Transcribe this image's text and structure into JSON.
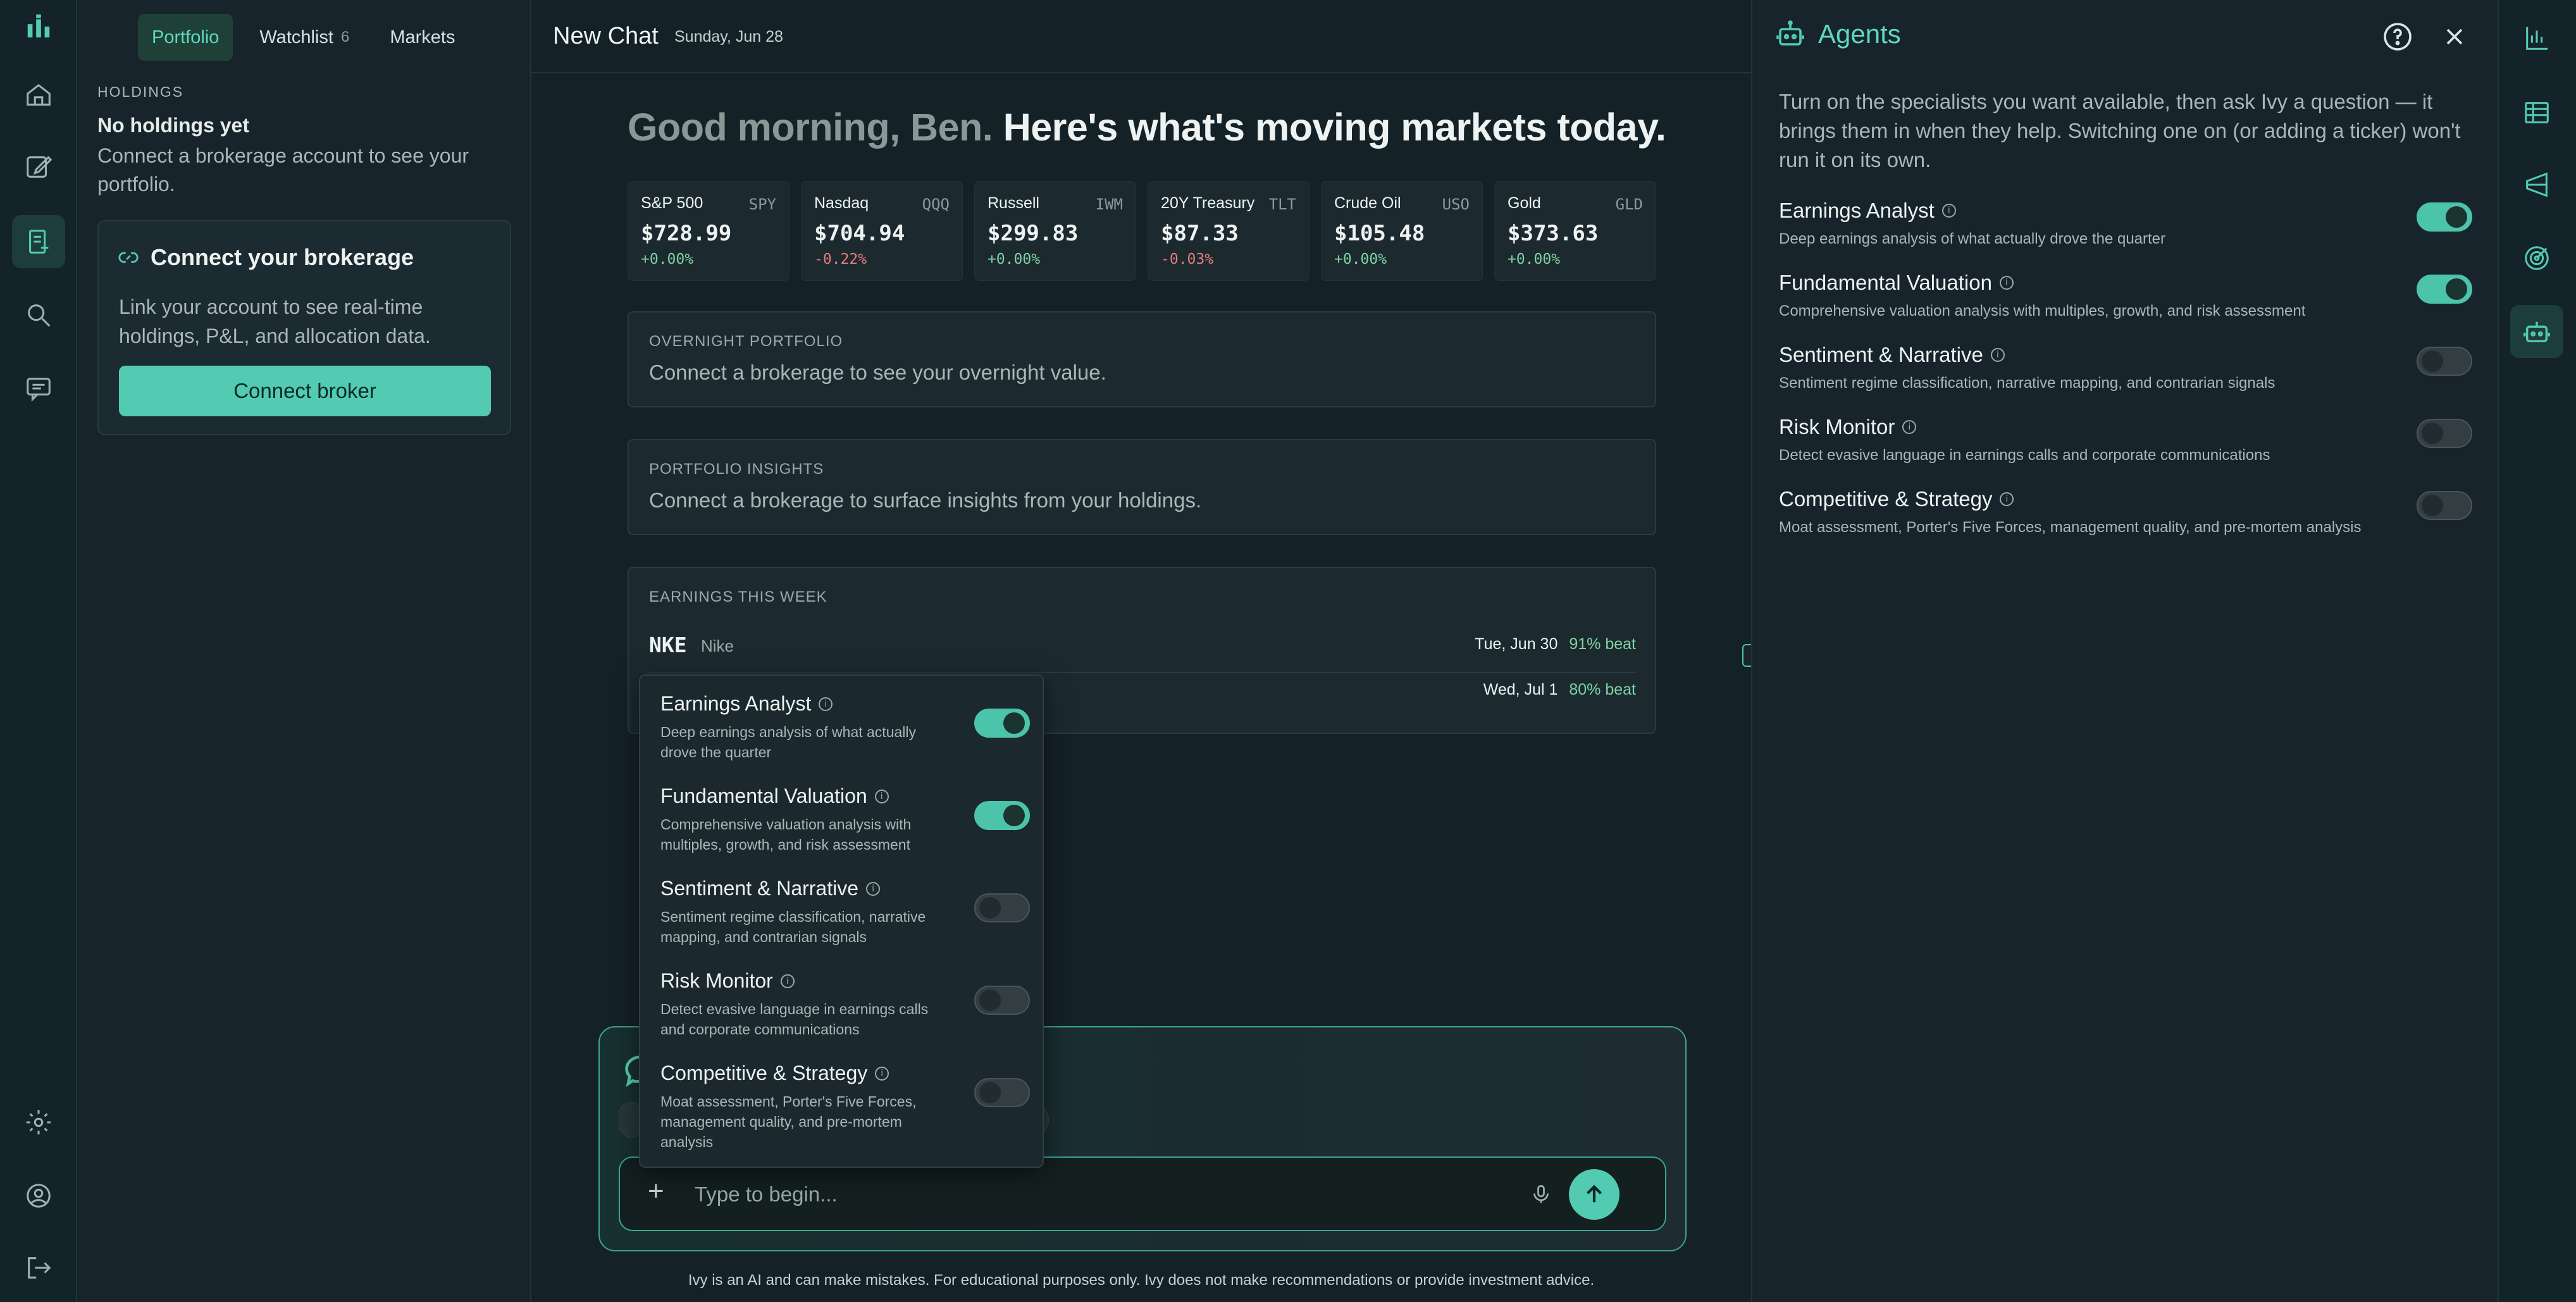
{
  "left_rail": {
    "items": [
      "logo-icon",
      "home-icon",
      "edit-icon",
      "portfolio-icon",
      "search-icon",
      "chat-icon",
      "settings-icon",
      "account-icon",
      "logout-icon"
    ]
  },
  "portfolio_panel": {
    "tabs": [
      {
        "label": "Portfolio",
        "active": true
      },
      {
        "label": "Watchlist",
        "count": "6"
      },
      {
        "label": "Markets"
      }
    ],
    "holdings_label": "HOLDINGS",
    "no_holdings_title": "No holdings yet",
    "no_holdings_desc": "Connect a brokerage account to see your portfolio.",
    "connect_card": {
      "title": "Connect your brokerage",
      "desc": "Link your account to see real-time holdings, P&L, and allocation data.",
      "button": "Connect broker"
    }
  },
  "header": {
    "title": "New Chat",
    "date": "Sunday, Jun 28"
  },
  "greeting": {
    "part1": "Good morning, Ben.",
    "part2": "Here's what's moving markets today."
  },
  "tickers": [
    {
      "name": "S&P 500",
      "symbol": "SPY",
      "price": "$728.99",
      "change": "+0.00%",
      "direction": "pos"
    },
    {
      "name": "Nasdaq",
      "symbol": "QQQ",
      "price": "$704.94",
      "change": "-0.22%",
      "direction": "neg"
    },
    {
      "name": "Russell",
      "symbol": "IWM",
      "price": "$299.83",
      "change": "+0.00%",
      "direction": "pos"
    },
    {
      "name": "20Y Treasury",
      "symbol": "TLT",
      "price": "$87.33",
      "change": "-0.03%",
      "direction": "neg"
    },
    {
      "name": "Crude Oil",
      "symbol": "USO",
      "price": "$105.48",
      "change": "+0.00%",
      "direction": "pos"
    },
    {
      "name": "Gold",
      "symbol": "GLD",
      "price": "$373.63",
      "change": "+0.00%",
      "direction": "pos"
    }
  ],
  "overnight": {
    "label": "OVERNIGHT PORTFOLIO",
    "text": "Connect a brokerage to see your overnight value."
  },
  "insights": {
    "label": "PORTFOLIO INSIGHTS",
    "text": "Connect a brokerage to surface insights from your holdings."
  },
  "earnings": {
    "label": "EARNINGS THIS WEEK",
    "rows": [
      {
        "ticker": "NKE",
        "company": "Nike",
        "date": "Tue, Jun 30",
        "beat": "91% beat"
      },
      {
        "ticker": "",
        "company": "",
        "date": "Wed, Jul 1",
        "beat": "80% beat"
      }
    ]
  },
  "composer": {
    "placeholder": "Type to begin...",
    "plus": "+"
  },
  "disclaimer": "Ivy is an AI and can make mistakes. For educational purposes only. Ivy does not make recommendations or provide investment advice.",
  "popover": {
    "items": [
      {
        "title": "Earnings Analyst",
        "desc": "Deep earnings analysis of what actually drove the quarter",
        "on": true
      },
      {
        "title": "Fundamental Valuation",
        "desc": "Comprehensive valuation analysis with multiples, growth, and risk assessment",
        "on": true
      },
      {
        "title": "Sentiment & Narrative",
        "desc": "Sentiment regime classification, narrative mapping, and contrarian signals",
        "on": false
      },
      {
        "title": "Risk Monitor",
        "desc": "Detect evasive language in earnings calls and corporate communications",
        "on": false
      },
      {
        "title": "Competitive & Strategy",
        "desc": "Moat assessment, Porter's Five Forces, management quality, and pre-mortem analysis",
        "on": false
      }
    ]
  },
  "agents_panel": {
    "title": "Agents",
    "desc": "Turn on the specialists you want available, then ask Ivy a question — it brings them in when they help. Switching one on (or adding a ticker) won't run it on its own.",
    "agents": [
      {
        "title": "Earnings Analyst",
        "desc": "Deep earnings analysis of what actually drove the quarter",
        "on": true
      },
      {
        "title": "Fundamental Valuation",
        "desc": "Comprehensive valuation analysis with multiples, growth, and risk assessment",
        "on": true
      },
      {
        "title": "Sentiment & Narrative",
        "desc": "Sentiment regime classification, narrative mapping, and contrarian signals",
        "on": false
      },
      {
        "title": "Risk Monitor",
        "desc": "Detect evasive language in earnings calls and corporate communications",
        "on": false
      },
      {
        "title": "Competitive & Strategy",
        "desc": "Moat assessment, Porter's Five Forces, management quality, and pre-mortem analysis",
        "on": false
      }
    ]
  },
  "right_rail": {
    "items": [
      "chart-icon",
      "table-icon",
      "megaphone-icon",
      "target-icon",
      "agent-robot-icon"
    ]
  },
  "colors": {
    "accent": "#52cbb2",
    "positive": "#7fd3a1",
    "negative": "#e97b7b",
    "background": "#142127"
  }
}
